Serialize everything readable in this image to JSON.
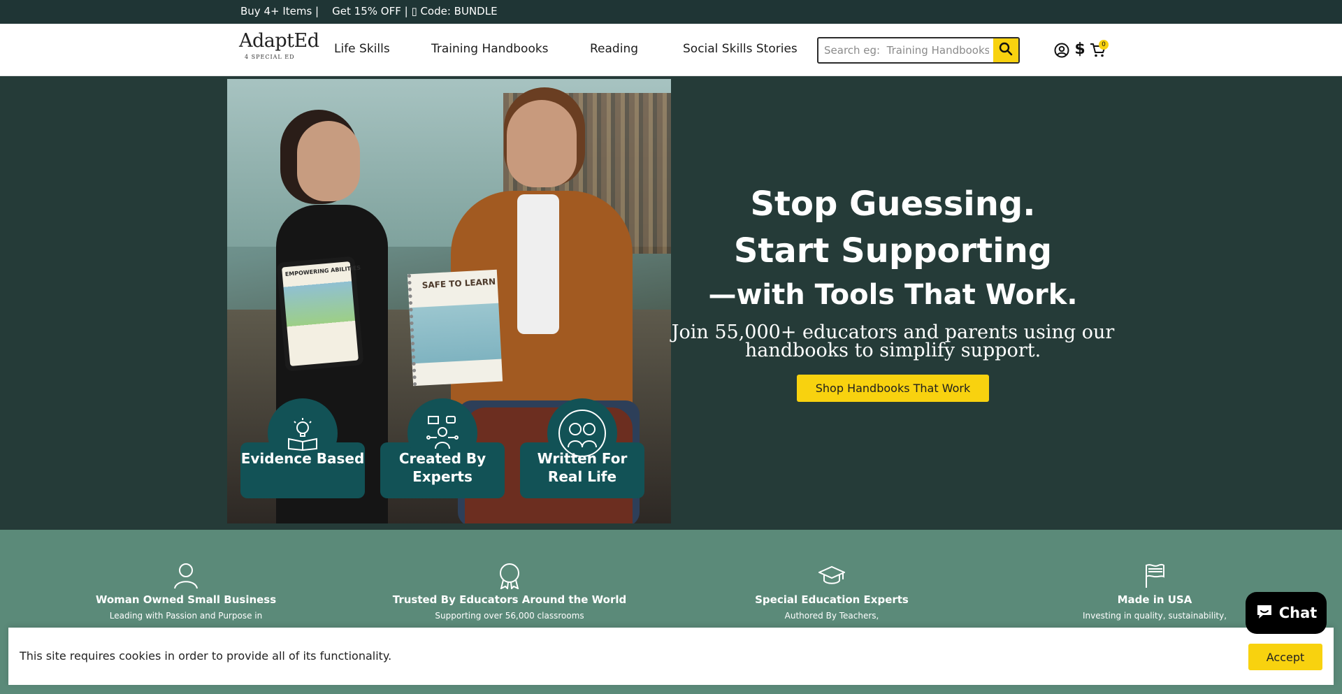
{
  "announcement": {
    "text": "Buy 4+ Items |    Get 15% OFF | ▯ Code: BUNDLE"
  },
  "header": {
    "logo": {
      "name": "AdaptEd",
      "tagline": "4 SPECIAL ED"
    },
    "nav": [
      {
        "label": "Life Skills"
      },
      {
        "label": "Training Handbooks"
      },
      {
        "label": "Reading"
      },
      {
        "label": "Social Skills Stories"
      }
    ],
    "search": {
      "placeholder": "Search eg:  Training Handbooks",
      "value": ""
    },
    "currency_symbol": "$",
    "cart_count": "0",
    "icons": [
      "account-icon",
      "currency-icon",
      "cart-icon",
      "search-icon"
    ]
  },
  "hero": {
    "image_text": {
      "tablet_title": "EMPOWERING ABILITIES",
      "book_title": "SAFE TO LEARN"
    },
    "badges": [
      {
        "label": "Evidence Based",
        "icon": "lightbulb-book-icon"
      },
      {
        "label": "Created By Experts",
        "icon": "expert-network-icon"
      },
      {
        "label": "Written For Real Life",
        "icon": "kids-icon"
      }
    ],
    "headline_1": "Stop Guessing.",
    "headline_2": "Start Supporting",
    "headline_3": "—with Tools That Work.",
    "subtext": "Join 55,000+ educators and parents using our handbooks to simplify support.",
    "cta_label": "Shop Handbooks That Work"
  },
  "features": [
    {
      "title": "Woman Owned Small Business",
      "desc": "Leading with Passion and Purpose in",
      "icon": "person-icon"
    },
    {
      "title": "Trusted By Educators Around the World",
      "desc": "Supporting over 56,000 classrooms",
      "icon": "award-ribbon-icon"
    },
    {
      "title": "Special Education Experts",
      "desc": "Authored By Teachers,",
      "icon": "graduation-cap-icon"
    },
    {
      "title": "Made in USA",
      "desc": "Investing in quality, sustainability,",
      "icon": "flag-icon"
    }
  ],
  "cookie": {
    "text": "This site requires cookies in order to provide all of its functionality.",
    "accept_label": "Accept"
  },
  "chat": {
    "label": "Chat"
  },
  "colors": {
    "announcement_bg": "#1f3535",
    "hero_bg": "#253b38",
    "accent_yellow": "#f8d20f",
    "badge_teal": "#125256",
    "features_bg": "#5b8a79"
  }
}
